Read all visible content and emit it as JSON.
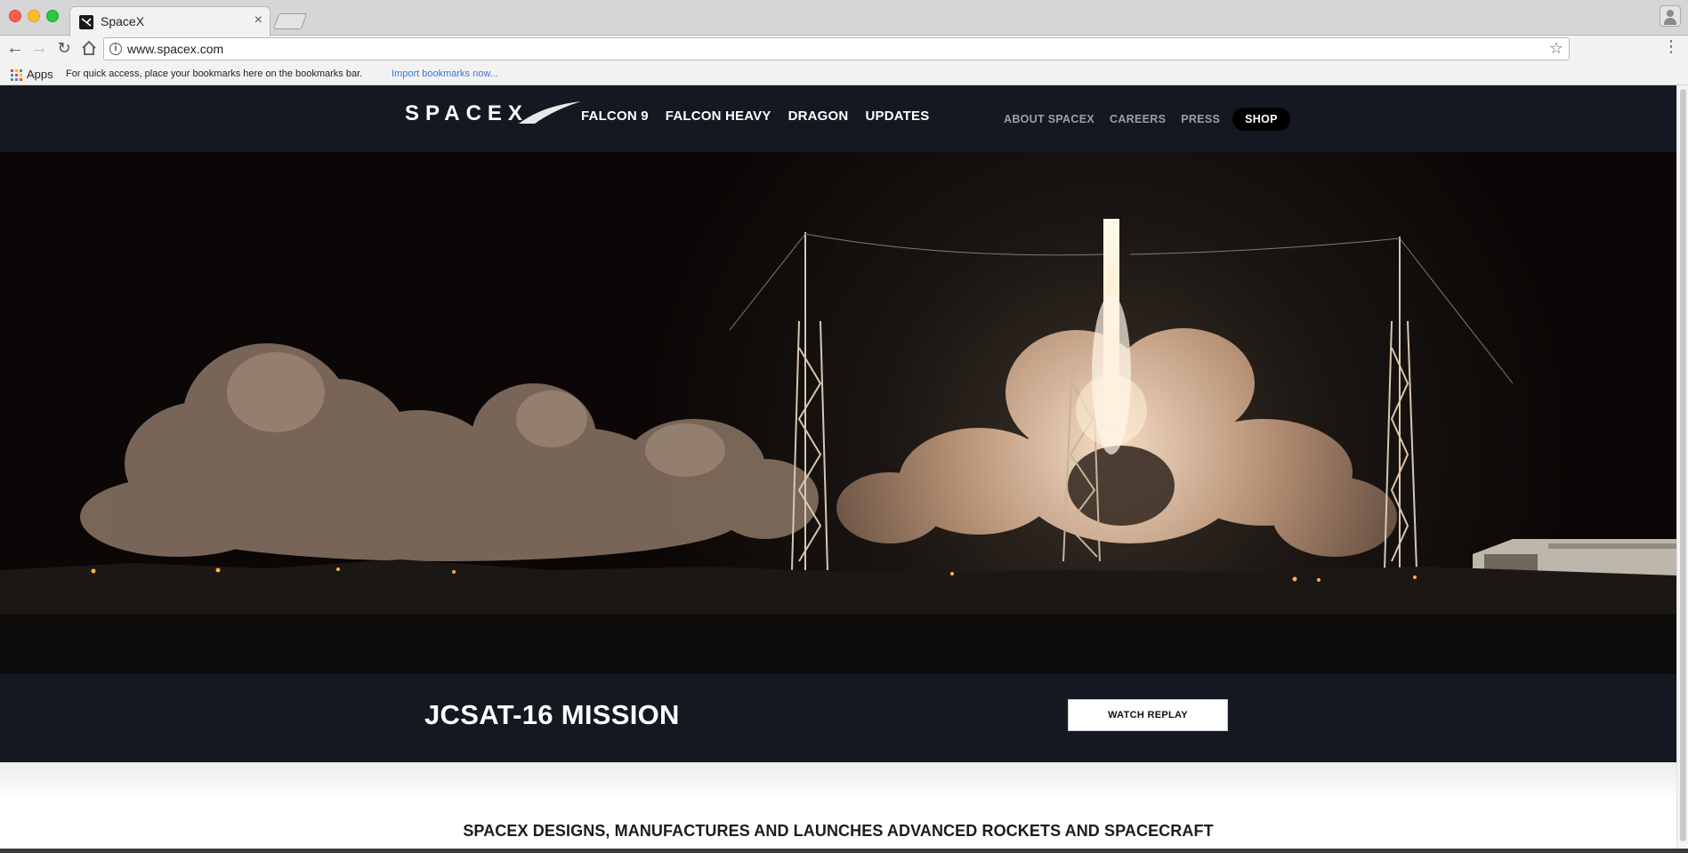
{
  "browser": {
    "tab_title": "SpaceX",
    "tab_close": "×",
    "url": "www.spacex.com",
    "bookmarks": {
      "apps_label": "Apps",
      "hint": "For quick access, place your bookmarks here on the bookmarks bar.",
      "import_link": "Import bookmarks now..."
    }
  },
  "site": {
    "logo_text": "SPACEX",
    "nav_main": [
      "FALCON 9",
      "FALCON HEAVY",
      "DRAGON",
      "UPDATES"
    ],
    "nav_secondary": [
      "ABOUT SPACEX",
      "CAREERS",
      "PRESS"
    ],
    "shop_label": "SHOP",
    "hero_image": "rocket-launch-photo",
    "mission": {
      "title": "JCSAT-16 MISSION",
      "button_label": "WATCH REPLAY"
    },
    "intro_heading": "SPACEX DESIGNS, MANUFACTURES AND LAUNCHES ADVANCED ROCKETS AND SPACECRAFT"
  },
  "colors": {
    "header_bg": "#141820",
    "apps_grid": [
      "#ea4335",
      "#fbbc05",
      "#34a853",
      "#4285f4"
    ],
    "link_blue": "#3f76d6"
  }
}
